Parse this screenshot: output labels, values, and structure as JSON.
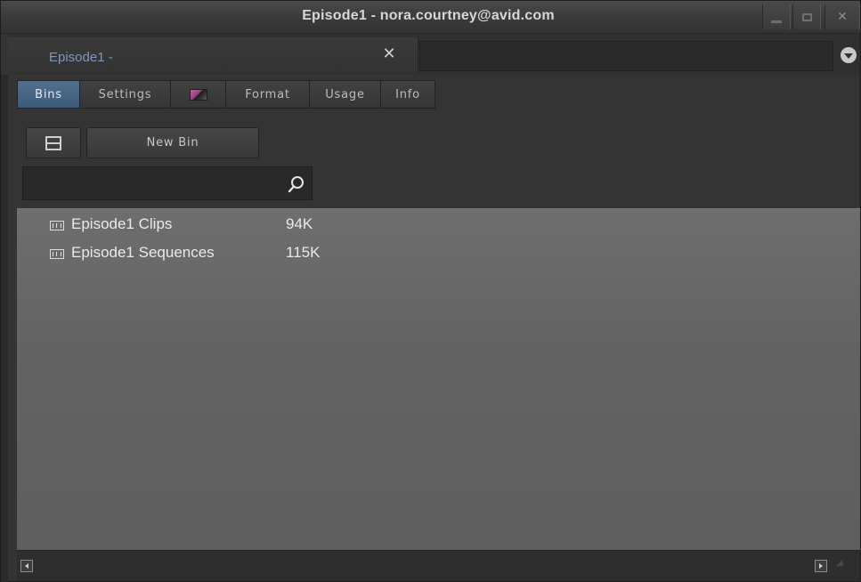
{
  "window": {
    "title": "Episode1 - nora.courtney@avid.com",
    "controls": [
      "minimize-icon",
      "maximize-icon",
      "close-icon"
    ]
  },
  "tabs": {
    "active_label": "Episode1 -",
    "close_glyph": "✕",
    "menu_icon": "chevron-down-circle-icon"
  },
  "subtabs": [
    {
      "label": "Bins",
      "active": true
    },
    {
      "label": "Settings",
      "active": false
    },
    {
      "label": "",
      "icon": "color-swatch-icon",
      "active": false
    },
    {
      "label": "Format",
      "active": false
    },
    {
      "label": "Usage",
      "active": false
    },
    {
      "label": "Info",
      "active": false
    }
  ],
  "toolbar": {
    "view_icon": "split-view-icon",
    "new_bin_label": "New Bin"
  },
  "search": {
    "value": "",
    "placeholder": "",
    "icon": "search-icon"
  },
  "bins": [
    {
      "name": "Episode1 Clips",
      "size": "94K"
    },
    {
      "name": "Episode1 Sequences",
      "size": "115K"
    }
  ],
  "colors": {
    "active_tab": "#4a6888",
    "tab_title": "#7f97c4",
    "list_background": "#666666"
  }
}
